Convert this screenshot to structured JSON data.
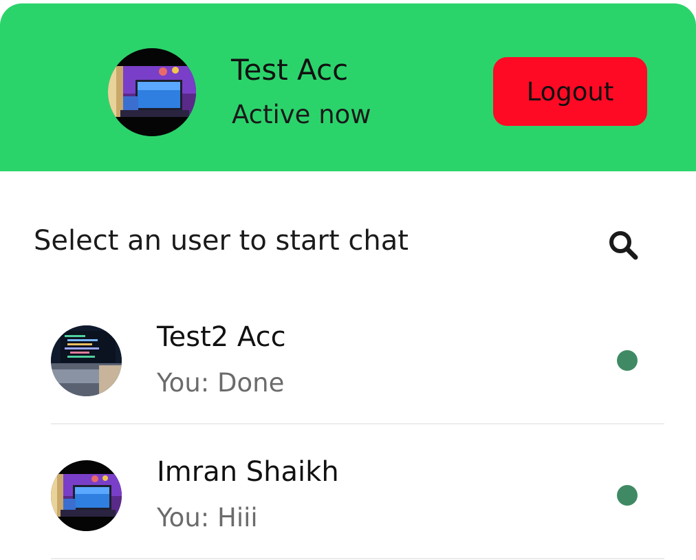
{
  "header": {
    "user_name": "Test Acc",
    "status": "Active now",
    "logout_label": "Logout",
    "avatar_icon": "profile-photo-desk-setup"
  },
  "search": {
    "prompt": "Select an user to start chat",
    "icon": "search-icon"
  },
  "users": [
    {
      "name": "Test2 Acc",
      "last_message": "You: Done",
      "avatar_icon": "profile-photo-code-laptop",
      "online": true
    },
    {
      "name": "Imran Shaikh",
      "last_message": "You: Hiii",
      "avatar_icon": "profile-photo-desk-setup",
      "online": true
    }
  ],
  "colors": {
    "header_bg": "#2bd46b",
    "logout_bg": "#ff0a25",
    "online_dot": "#3f8a64",
    "muted_text": "#6b6b6b"
  }
}
